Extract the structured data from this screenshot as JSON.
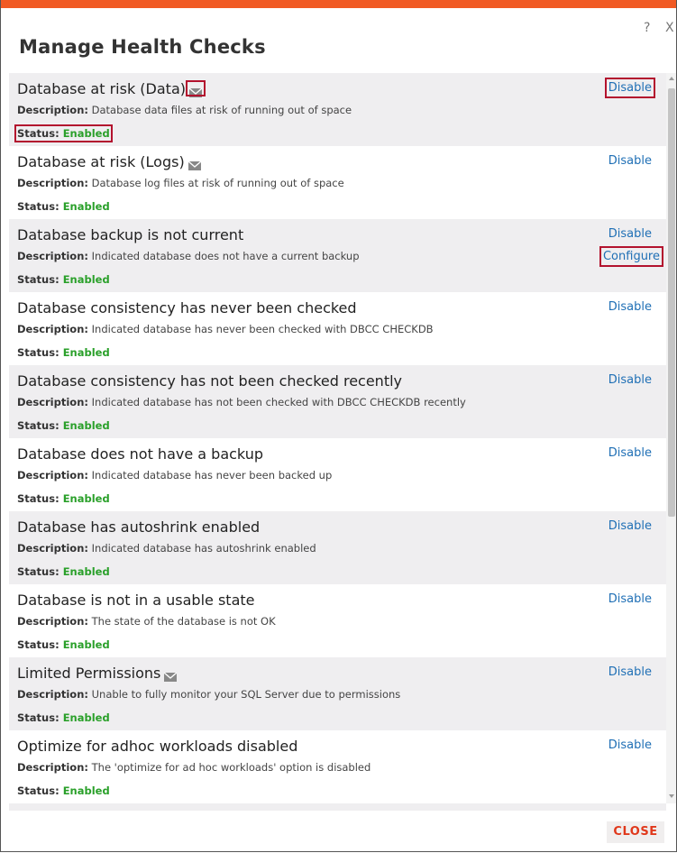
{
  "dialog": {
    "title": "Manage Health Checks",
    "help_label": "?",
    "close_x_label": "X",
    "footer_close_label": "CLOSE"
  },
  "labels": {
    "description": "Description:",
    "status": "Status:"
  },
  "checks": [
    {
      "name": "Database at risk (Data)",
      "mail": true,
      "description": "Database data files at risk of running out of space",
      "status": "Enabled",
      "action": "Disable"
    },
    {
      "name": "Database at risk (Logs)",
      "mail": true,
      "description": "Database log files at risk of running out of space",
      "status": "Enabled",
      "action": "Disable"
    },
    {
      "name": "Database backup is not current",
      "mail": false,
      "description": "Indicated database does not have a current backup",
      "status": "Enabled",
      "action": "Disable",
      "action2": "Configure"
    },
    {
      "name": "Database consistency has never been checked",
      "mail": false,
      "description": "Indicated database has never been checked with DBCC CHECKDB",
      "status": "Enabled",
      "action": "Disable"
    },
    {
      "name": "Database consistency has not been checked recently",
      "mail": false,
      "description": "Indicated database has not been checked with DBCC CHECKDB recently",
      "status": "Enabled",
      "action": "Disable"
    },
    {
      "name": "Database does not have a backup",
      "mail": false,
      "description": "Indicated database has never been backed up",
      "status": "Enabled",
      "action": "Disable"
    },
    {
      "name": "Database has autoshrink enabled",
      "mail": false,
      "description": "Indicated database has autoshrink enabled",
      "status": "Enabled",
      "action": "Disable"
    },
    {
      "name": "Database is not in a usable state",
      "mail": false,
      "description": "The state of the database is not OK",
      "status": "Enabled",
      "action": "Disable"
    },
    {
      "name": "Limited Permissions",
      "mail": true,
      "description": "Unable to fully monitor your SQL Server due to permissions",
      "status": "Enabled",
      "action": "Disable"
    },
    {
      "name": "Optimize for adhoc workloads disabled",
      "mail": false,
      "description": "The 'optimize for ad hoc workloads' option is disabled",
      "status": "Enabled",
      "action": "Disable"
    }
  ],
  "colors": {
    "accent_bar": "#f15a24",
    "link": "#1f6fb5",
    "enabled": "#2aa02a",
    "close_text": "#e0381b",
    "highlight_box": "#b3122e"
  },
  "icons": {
    "mail": "mail-icon",
    "scroll_up": "scroll-up-arrow-icon",
    "scroll_down": "scroll-down-arrow-icon"
  }
}
